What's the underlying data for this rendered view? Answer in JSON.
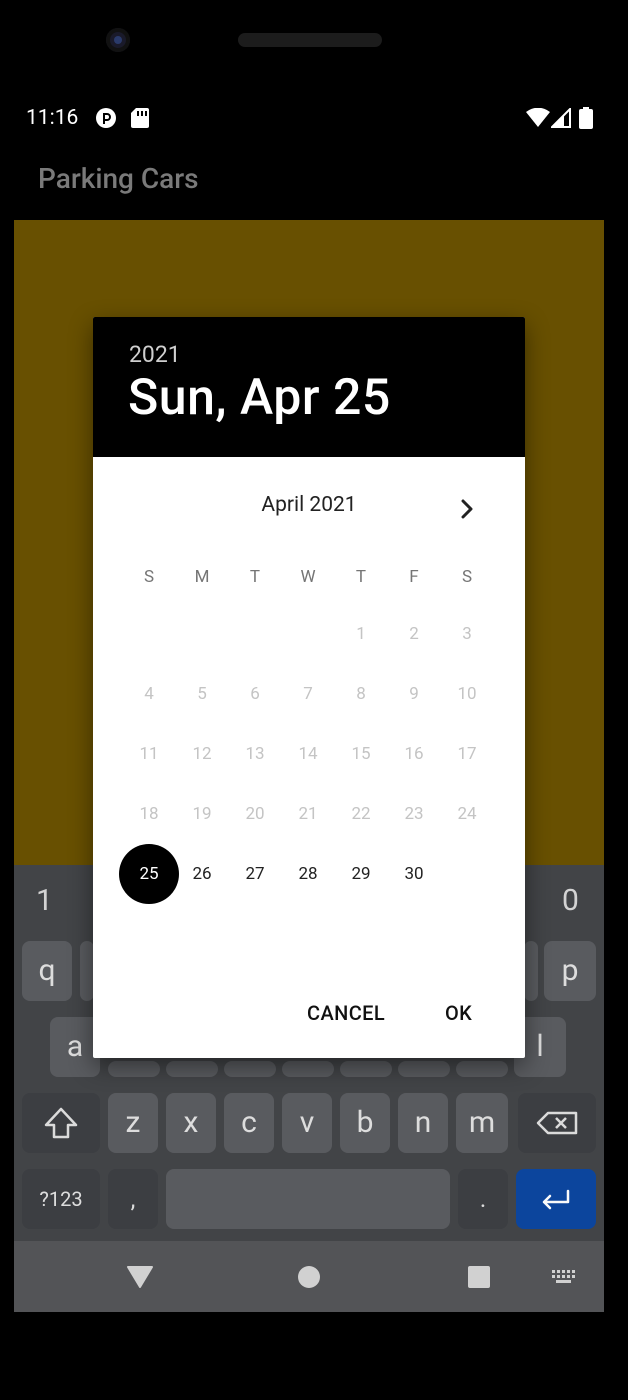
{
  "status_bar": {
    "time": "11:16"
  },
  "app": {
    "title": "Parking Cars"
  },
  "dialog": {
    "year": "2021",
    "selected_date": "Sun, Apr 25",
    "month_label": "April 2021",
    "weekdays": [
      "S",
      "M",
      "T",
      "W",
      "T",
      "F",
      "S"
    ],
    "weeks": [
      [
        "",
        "",
        "",
        "",
        "1",
        "2",
        "3"
      ],
      [
        "4",
        "5",
        "6",
        "7",
        "8",
        "9",
        "10"
      ],
      [
        "11",
        "12",
        "13",
        "14",
        "15",
        "16",
        "17"
      ],
      [
        "18",
        "19",
        "20",
        "21",
        "22",
        "23",
        "24"
      ],
      [
        "25",
        "26",
        "27",
        "28",
        "29",
        "30",
        ""
      ]
    ],
    "selected_day": "25",
    "cancel_label": "CANCEL",
    "ok_label": "OK"
  },
  "keyboard": {
    "number_row_left": "1",
    "number_row_right": "0",
    "row1_left": "q",
    "row1_right": "p",
    "row2_left": "a",
    "row2_right": "l",
    "row3": [
      "z",
      "x",
      "c",
      "v",
      "b",
      "n",
      "m"
    ],
    "symbols_label": "?123",
    "comma_label": ",",
    "period_label": "."
  },
  "colors": {
    "content_background": "#6b5202",
    "keyboard_enter": "#0d47a1",
    "dialog_header": "#000000"
  }
}
